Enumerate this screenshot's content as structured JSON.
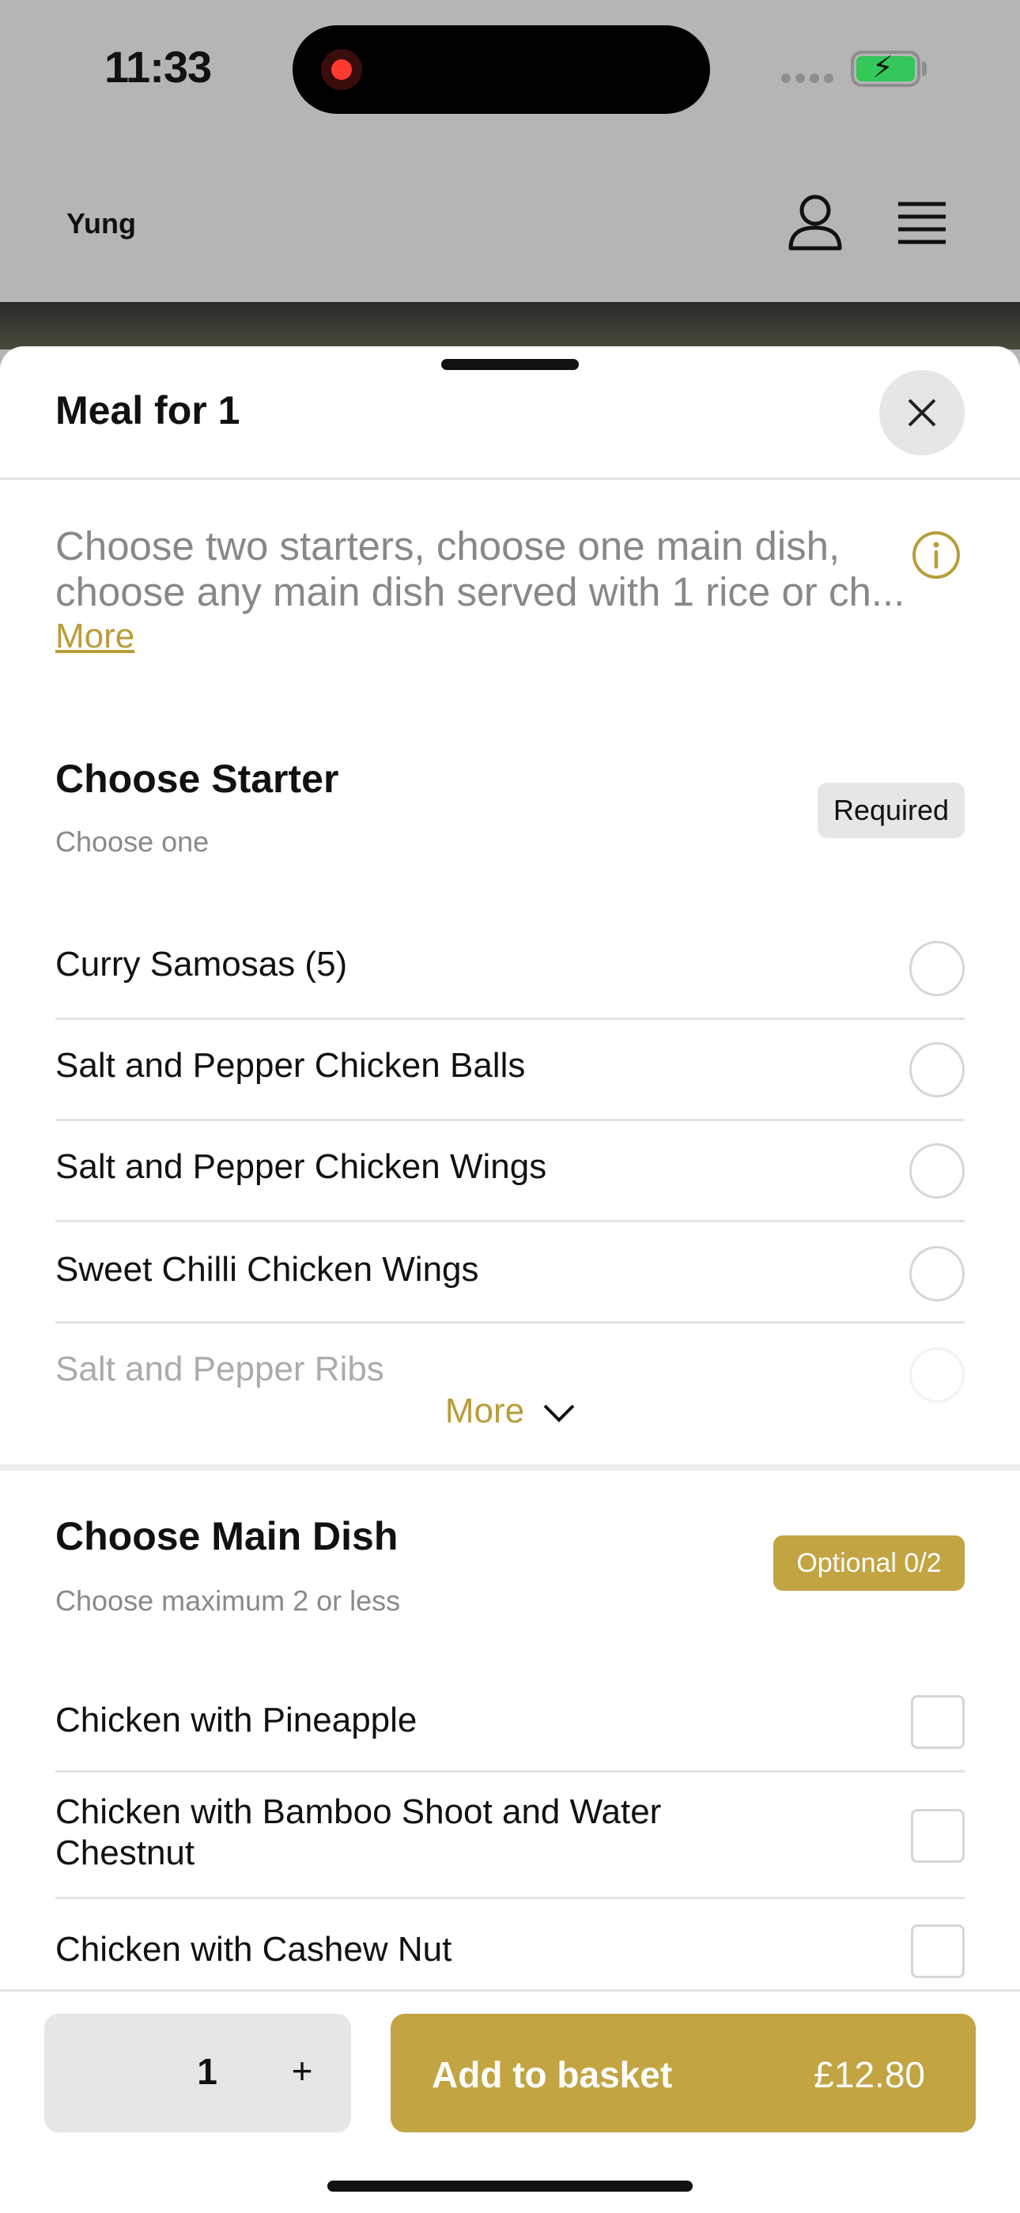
{
  "status_bar": {
    "time": "11:33"
  },
  "header": {
    "brand": "Yung"
  },
  "sheet": {
    "title": "Meal for 1",
    "description_line1": "Choose two starters, choose one main dish,",
    "description_line2": "choose any main dish served with 1 rice or ch...",
    "description_more": "More"
  },
  "starter": {
    "title": "Choose Starter",
    "subtitle": "Choose one",
    "badge": "Required",
    "options": [
      "Curry Samosas (5)",
      "Salt and Pepper Chicken Balls",
      "Salt and Pepper Chicken Wings",
      "Sweet Chilli Chicken Wings",
      "Salt and Pepper Ribs"
    ],
    "more_label": "More"
  },
  "main": {
    "title": "Choose Main Dish",
    "subtitle": "Choose maximum 2 or less",
    "badge": "Optional 0/2",
    "options": [
      "Chicken with Pineapple",
      "Chicken with Bamboo Shoot and Water",
      "Chestnut",
      "Chicken with Cashew Nut"
    ]
  },
  "footer": {
    "quantity": "1",
    "plus": "+",
    "add_label": "Add to basket",
    "price": "£12.80"
  },
  "colors": {
    "accent": "#c2a443",
    "link": "#b89d3a"
  },
  "icons": [
    "record-icon",
    "battery-icon",
    "user-icon",
    "menu-icon",
    "close-icon",
    "info-icon",
    "chevron-down-icon"
  ]
}
